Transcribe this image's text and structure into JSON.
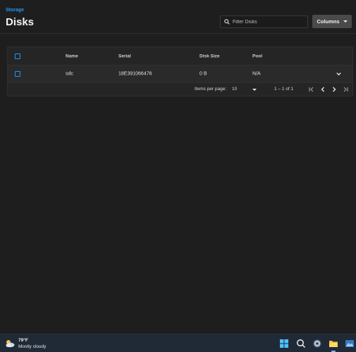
{
  "header": {
    "breadcrumb": "Storage",
    "title": "Disks",
    "filter_placeholder": "Filter Disks",
    "columns_label": "Columns"
  },
  "table": {
    "columns": [
      "Name",
      "Serial",
      "Disk Size",
      "Pool"
    ],
    "rows": [
      {
        "name": "sdc",
        "serial": "18E391066476",
        "size": "0 B",
        "pool": "N/A"
      }
    ]
  },
  "paginator": {
    "items_per_page_label": "Items per page:",
    "page_size": "10",
    "range": "1 – 1 of 1"
  },
  "taskbar": {
    "weather_temp": "79°F",
    "weather_desc": "Mostly cloudy"
  },
  "colors": {
    "accent": "#2196f3",
    "background": "#1e1e1e",
    "taskbar": "#202a36"
  }
}
